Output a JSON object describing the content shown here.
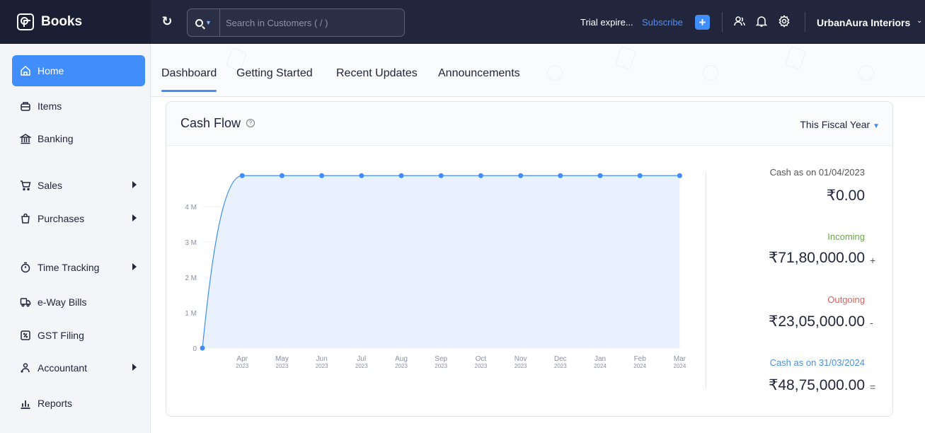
{
  "app": {
    "name": "Books"
  },
  "header": {
    "search_placeholder": "Search in Customers ( / )",
    "trial_text": "Trial expire...",
    "subscribe_label": "Subscribe",
    "add_label": "+",
    "org_name": "UrbanAura Interiors"
  },
  "sidebar": {
    "items": [
      {
        "label": "Home",
        "icon": "home-icon",
        "active": true
      },
      {
        "label": "Items",
        "icon": "items-icon"
      },
      {
        "label": "Banking",
        "icon": "bank-icon"
      },
      {
        "label": "Sales",
        "icon": "cart-icon",
        "submenu": true
      },
      {
        "label": "Purchases",
        "icon": "bag-icon",
        "submenu": true
      },
      {
        "label": "Time Tracking",
        "icon": "stopwatch-icon",
        "submenu": true
      },
      {
        "label": "e-Way Bills",
        "icon": "truck-icon"
      },
      {
        "label": "GST Filing",
        "icon": "gst-icon"
      },
      {
        "label": "Accountant",
        "icon": "accountant-icon",
        "submenu": true
      },
      {
        "label": "Reports",
        "icon": "reports-icon"
      }
    ]
  },
  "tabs": [
    {
      "label": "Dashboard",
      "active": true
    },
    {
      "label": "Getting Started"
    },
    {
      "label": "Recent Updates"
    },
    {
      "label": "Announcements"
    }
  ],
  "cashflow": {
    "title": "Cash Flow",
    "period": "This Fiscal Year",
    "opening_label": "Cash as on 01/04/2023",
    "opening_value": "₹0.00",
    "incoming_label": "Incoming",
    "incoming_value": "₹71,80,000.00",
    "incoming_suffix": "+",
    "outgoing_label": "Outgoing",
    "outgoing_value": "₹23,05,000.00",
    "outgoing_suffix": "-",
    "closing_label": "Cash as on 31/03/2024",
    "closing_value": "₹48,75,000.00",
    "closing_suffix": "="
  },
  "colors": {
    "accent": "#408dfb",
    "incoming": "#6aa84f",
    "outgoing": "#e06060",
    "closing": "#4a90e2",
    "line": "#408dfb",
    "area": "#e8f1fd"
  },
  "chart_data": {
    "type": "area",
    "x": [
      "",
      "Apr 2023",
      "May 2023",
      "Jun 2023",
      "Jul 2023",
      "Aug 2023",
      "Sep 2023",
      "Oct 2023",
      "Nov 2023",
      "Dec 2023",
      "Jan 2024",
      "Feb 2024",
      "Mar 2024"
    ],
    "x_ticks": [
      {
        "month": "Apr",
        "year": "2023"
      },
      {
        "month": "May",
        "year": "2023"
      },
      {
        "month": "Jun",
        "year": "2023"
      },
      {
        "month": "Jul",
        "year": "2023"
      },
      {
        "month": "Aug",
        "year": "2023"
      },
      {
        "month": "Sep",
        "year": "2023"
      },
      {
        "month": "Oct",
        "year": "2023"
      },
      {
        "month": "Nov",
        "year": "2023"
      },
      {
        "month": "Dec",
        "year": "2023"
      },
      {
        "month": "Jan",
        "year": "2024"
      },
      {
        "month": "Feb",
        "year": "2024"
      },
      {
        "month": "Mar",
        "year": "2024"
      }
    ],
    "values": [
      0,
      4875000,
      4875000,
      4875000,
      4875000,
      4875000,
      4875000,
      4875000,
      4875000,
      4875000,
      4875000,
      4875000,
      4875000
    ],
    "y_ticks": [
      "0",
      "1 M",
      "2 M",
      "3 M",
      "4 M"
    ],
    "y_tick_values": [
      0,
      1000000,
      2000000,
      3000000,
      4000000
    ],
    "ylim": [
      0,
      5000000
    ],
    "grid": true
  }
}
